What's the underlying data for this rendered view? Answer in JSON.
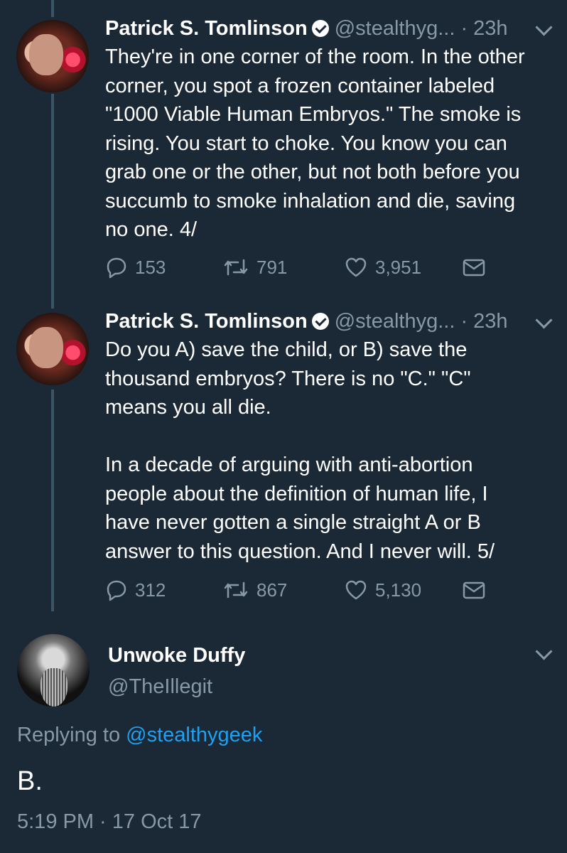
{
  "tweets": [
    {
      "name": "Patrick S. Tomlinson",
      "handle": "@stealthyg... · 23h",
      "text": "They're in one corner of the room. In the other\ncorner, you spot a frozen container labeled\n\"1000 Viable Human Embryos.\" The smoke is\nrising. You start to choke. You know you can\ngrab one or the other, but not both before you\nsuccumb to smoke inhalation and die, saving\nno one. 4/",
      "replies": "153",
      "retweets": "791",
      "likes": "3,951"
    },
    {
      "name": "Patrick S. Tomlinson",
      "handle": "@stealthyg... · 23h",
      "text": "Do you A) save the child, or B) save the\nthousand embryos? There is no \"C.\" \"C\"\nmeans you all die.\n\nIn a decade of arguing with anti-abortion\npeople about the definition of human life, I\nhave never gotten a single straight A or B\nanswer to this question. And I never will. 5/",
      "replies": "312",
      "retweets": "867",
      "likes": "5,130"
    }
  ],
  "reply": {
    "name": "Unwoke Duffy",
    "handle": "@TheIllegit",
    "replying_prefix": "Replying to ",
    "replying_mention": "@stealthygeek",
    "text": "B.",
    "timestamp": "5:19 PM · 17 Oct 17"
  },
  "colors": {
    "background": "#1b2836",
    "secondary_text": "#8899a6",
    "mention": "#1da1f2"
  },
  "icons": [
    "verified-badge-icon",
    "chevron-down-icon",
    "reply-icon",
    "retweet-icon",
    "like-icon",
    "direct-message-icon"
  ]
}
